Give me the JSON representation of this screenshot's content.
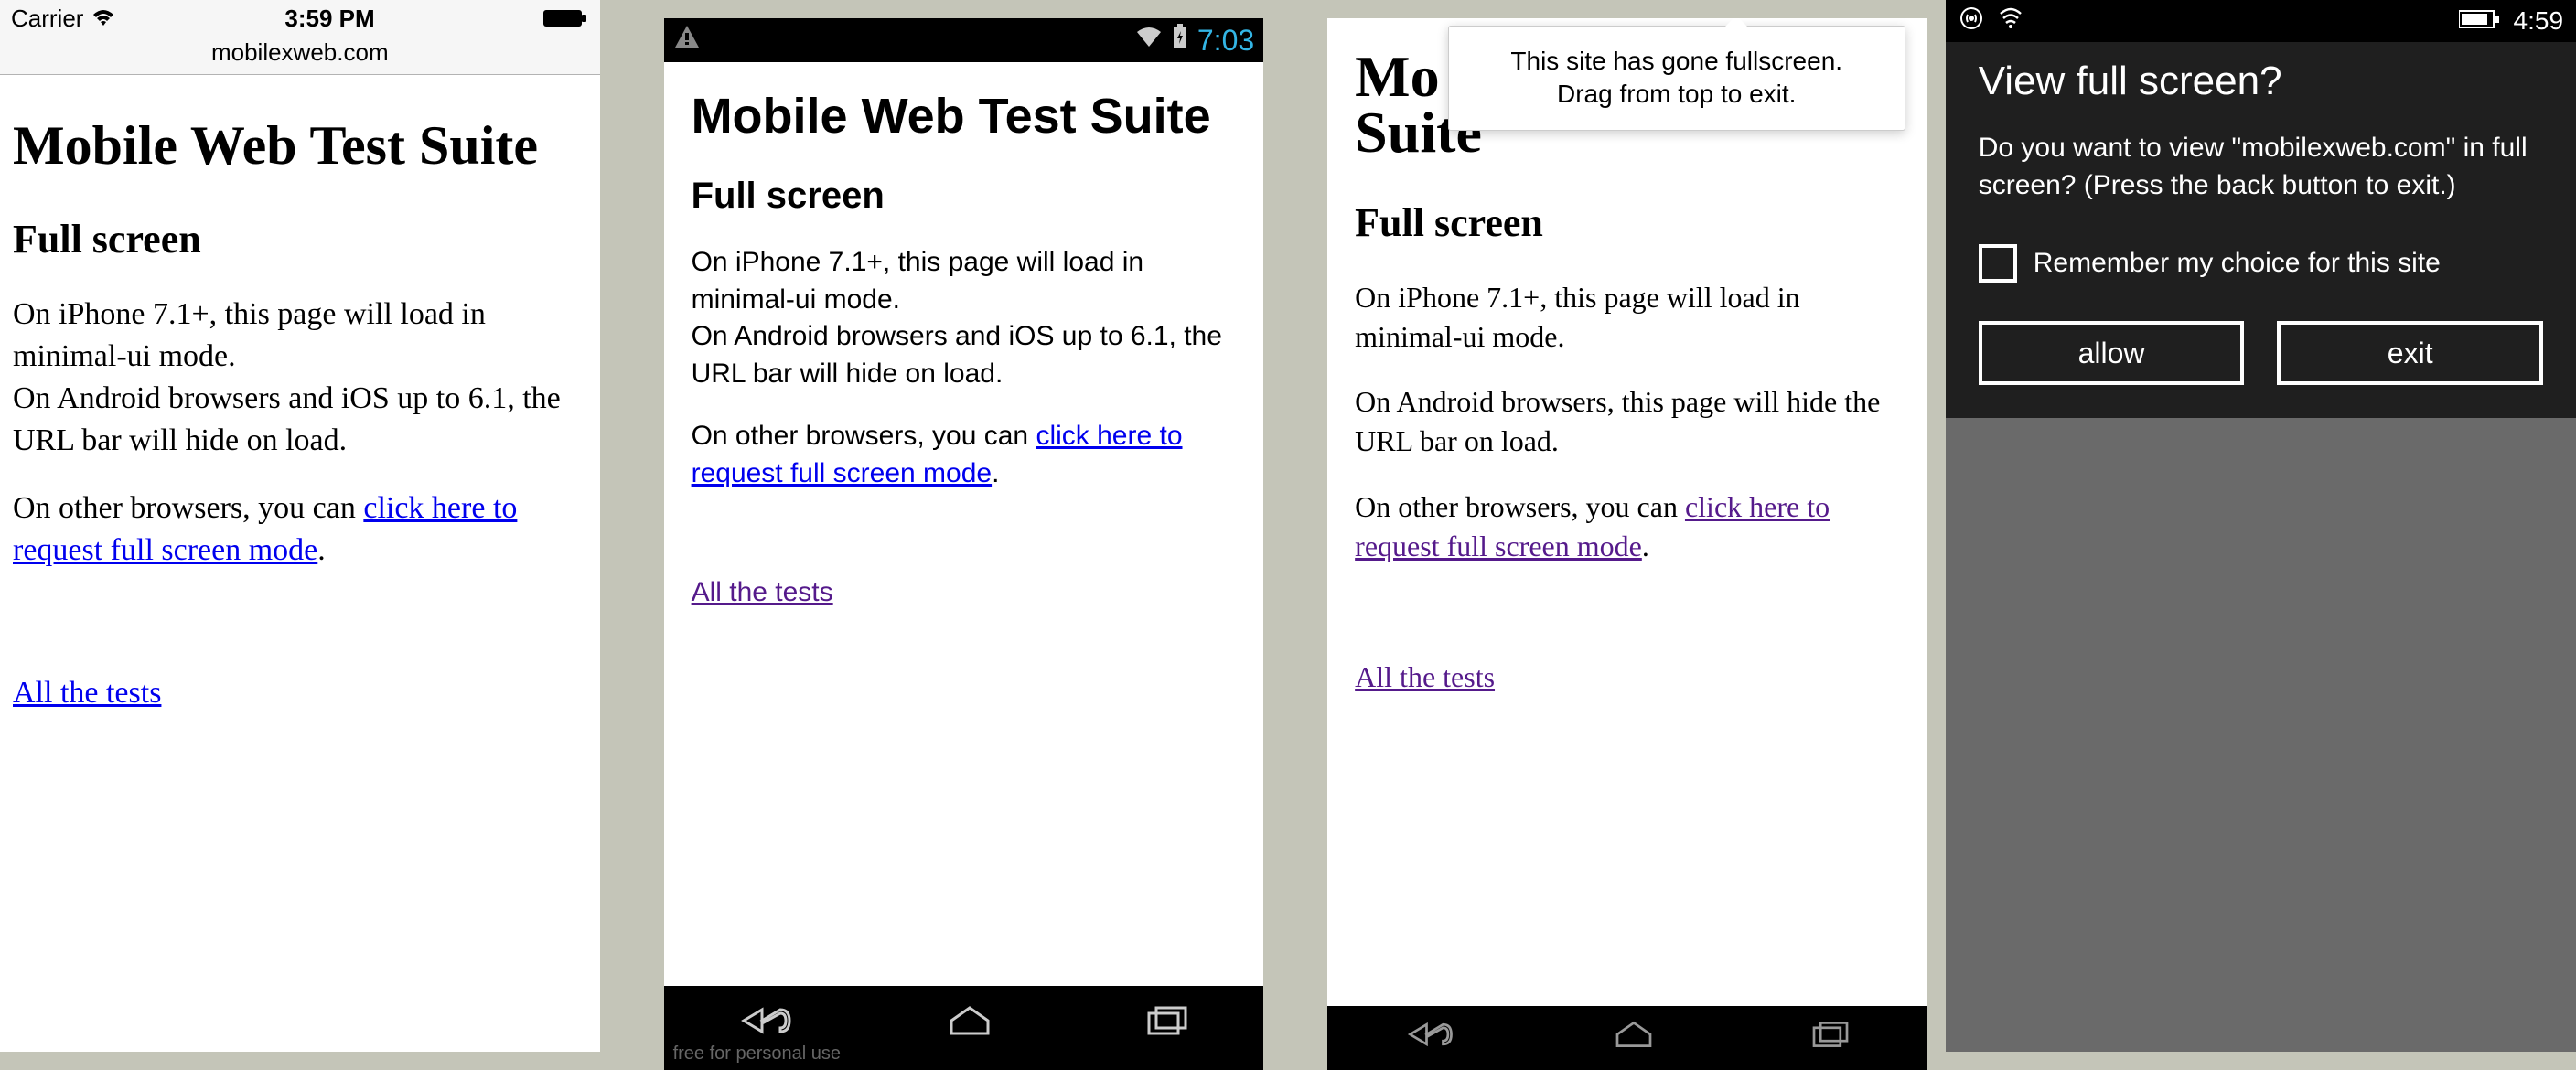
{
  "panel1": {
    "carrier": "Carrier",
    "time": "3:59 PM",
    "url": "mobilexweb.com",
    "h1": "Mobile Web Test Suite",
    "h2": "Full screen",
    "para1": "On iPhone 7.1+, this page will load in minimal-ui mode.\nOn Android browsers and iOS up to 6.1, the URL bar will hide on load.",
    "para2_prefix": "On other browsers, you can ",
    "para2_link": "click here to request full screen mode",
    "para2_suffix": ".",
    "alltests": "All the tests"
  },
  "panel2": {
    "time": "7:03",
    "h1": "Mobile Web Test Suite",
    "h2": "Full screen",
    "para1": "On iPhone 7.1+, this page will load in minimal-ui mode.\nOn Android browsers and iOS up to 6.1, the URL bar will hide on load.",
    "para2_prefix": "On other browsers, you can ",
    "para2_link": "click here to request full screen mode",
    "para2_suffix": ".",
    "alltests": "All the tests",
    "footerlabel": "free for personal use"
  },
  "panel3": {
    "toast_line1": "This site has gone fullscreen.",
    "toast_line2": "Drag from top to exit.",
    "h1_visible": "Mo\nSuite",
    "h2": "Full screen",
    "para1": "On iPhone 7.1+, this page will load in minimal-ui mode.",
    "para1b": "On Android browsers, this page will hide the URL bar on load.",
    "para2_prefix": "On other browsers, you can ",
    "para2_link": "click here to request full screen mode",
    "para2_suffix": ".",
    "alltests": "All the tests"
  },
  "panel4": {
    "time": "4:59",
    "title": "View full screen?",
    "body": "Do you want to view \"mobilexweb.com\" in full screen? (Press the back button to exit.)",
    "remember": "Remember my choice for this site",
    "allow": "allow",
    "exit": "exit"
  }
}
